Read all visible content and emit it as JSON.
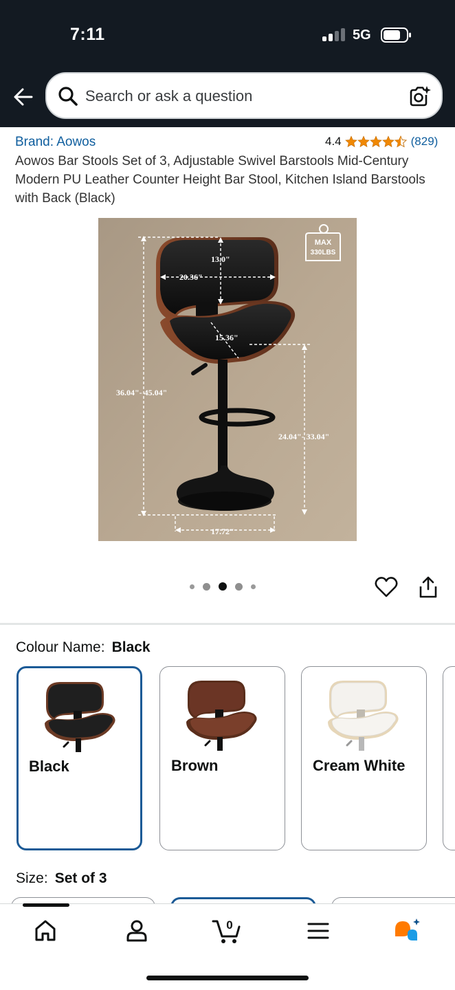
{
  "status_bar": {
    "time": "7:11",
    "network": "5G",
    "signal_bars_active": 2,
    "signal_bars_total": 4
  },
  "search": {
    "placeholder": "Search or ask a question"
  },
  "product": {
    "brand_label": "Brand: Aowos",
    "rating_value": "4.4",
    "rating_stars": 4.4,
    "review_count": "(829)",
    "title": "Aowos Bar Stools Set of 3, Adjustable Swivel Barstools Mid-Century Modern PU Leather Counter Height Bar Stool, Kitchen Island Barstools with Back (Black)",
    "image": {
      "background_color": "#b5a48e",
      "badge_line1": "MAX",
      "badge_line2": "330LBS",
      "dim_back_height": "13.0\"",
      "dim_back_width": "20.36\"",
      "dim_seat_depth": "15.36\"",
      "dim_total_height": "36.04\"- 45.04\"",
      "dim_seat_height": "24.04\"- 33.04\"",
      "dim_base_width": "17.72\""
    },
    "carousel": {
      "count": 5,
      "active_index": 2
    }
  },
  "colour": {
    "label": "Colour Name:",
    "selected": "Black",
    "options": [
      {
        "label": "Black",
        "color": "#1f1f1f",
        "wood": "#6b3a25",
        "selected": true
      },
      {
        "label": "Brown",
        "color": "#6b3525",
        "wood": "#6b3a25",
        "selected": false
      },
      {
        "label": "Cream White",
        "color": "#f2f0ec",
        "wood": "#e6d6b8",
        "selected": false
      }
    ]
  },
  "size": {
    "label": "Size:",
    "selected": "Set of 3"
  },
  "nav": {
    "items": [
      "home-icon",
      "account-icon",
      "cart-icon",
      "menu-icon",
      "rufus-assistant-icon"
    ],
    "cart_count": "0"
  },
  "colors": {
    "header_bg": "#131a22",
    "link": "#0f5e9e",
    "star": "#f08804",
    "selected_border": "#1b5a96",
    "assistant_orange": "#ff7a00",
    "assistant_blue": "#1b9ce6"
  }
}
